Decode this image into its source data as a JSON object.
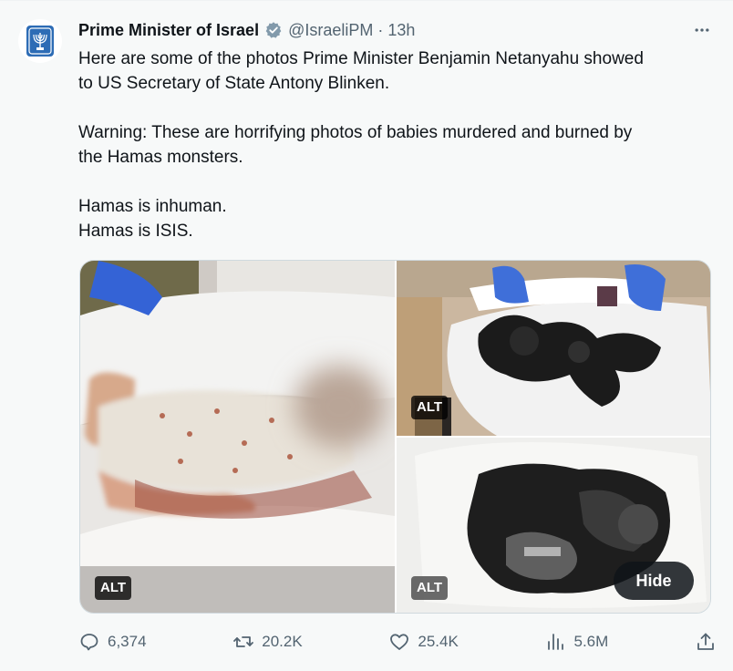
{
  "author": {
    "display_name": "Prime Minister of Israel",
    "handle": "@IsraeliPM",
    "separator": "·",
    "time": "13h",
    "verified_color": "#829aab"
  },
  "tweet": {
    "lines": [
      "Here are some of the photos Prime Minister Benjamin Netanyahu showed",
      "to US Secretary of State Antony Blinken.",
      "",
      "Warning: These are horrifying photos of babies murdered and burned by",
      "the Hamas monsters.",
      "",
      "Hamas is inhuman.",
      "Hamas is ISIS."
    ]
  },
  "media": {
    "alt_label": "ALT",
    "hide_label": "Hide"
  },
  "actions": {
    "replies": "6,374",
    "reposts": "20.2K",
    "likes": "25.4K",
    "views": "5.6M"
  },
  "icons": {
    "avatar": "israel-emblem-icon",
    "verified": "verified-badge-icon",
    "more": "more-dots-icon",
    "reply": "reply-icon",
    "repost": "repost-icon",
    "like": "heart-icon",
    "views": "views-icon",
    "share": "share-icon"
  },
  "colors": {
    "text": "#0f1419",
    "muted": "#536471",
    "background": "#f7f9f9",
    "emblem": "#2d6cb5"
  }
}
